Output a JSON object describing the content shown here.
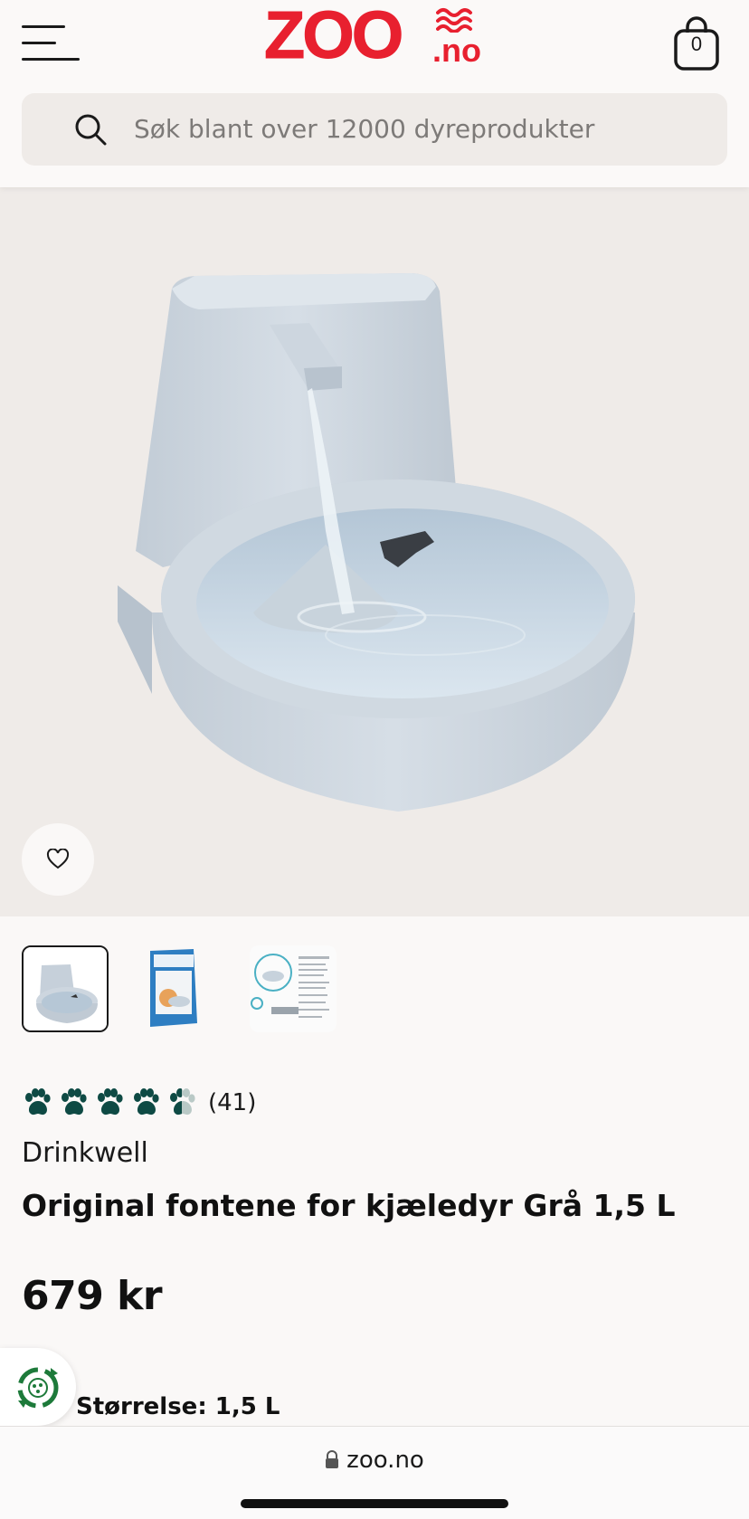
{
  "header": {
    "logo_text": "ZOO",
    "logo_suffix": ".no",
    "cart_count": "0"
  },
  "search": {
    "placeholder": "Søk blant over 12000 dyreprodukter"
  },
  "product": {
    "rating_count": "(41)",
    "rating": 4.5,
    "rating_max": 5,
    "brand": "Drinkwell",
    "title": "Original fontene for kjæledyr Grå 1,5 L",
    "price": "679 kr",
    "size_label": "Størrelse: 1,5 L",
    "thumbnails": [
      "thumbnail-fountain",
      "thumbnail-box",
      "thumbnail-instructions"
    ],
    "active_thumbnail": 0
  },
  "browser": {
    "url": "zoo.no"
  },
  "colors": {
    "brand_red": "#e8202f",
    "paw_green": "#0e4a44",
    "image_bg": "#efebe8",
    "page_bg": "#faf8f7"
  },
  "icons": [
    "menu-icon",
    "cart-bag-icon",
    "search-icon",
    "heart-icon",
    "paw-icon",
    "recycle-icon",
    "lock-icon"
  ]
}
